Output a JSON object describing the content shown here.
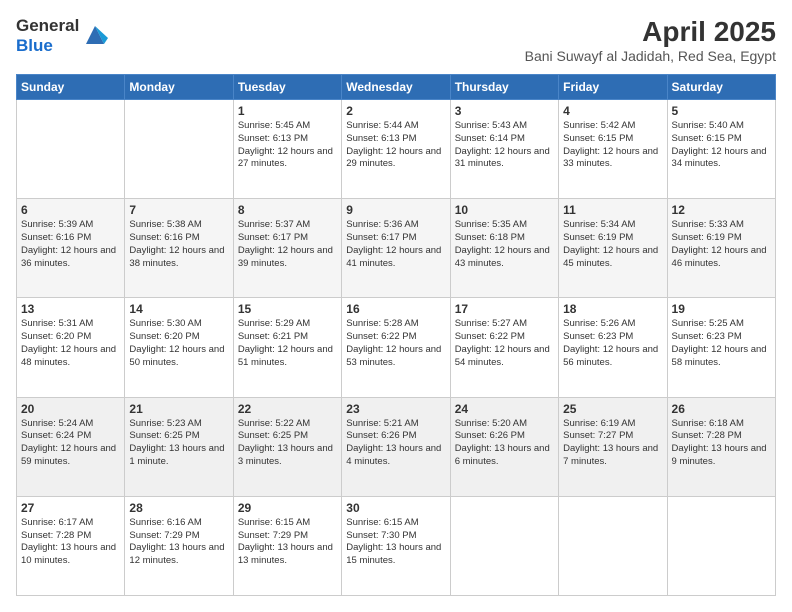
{
  "logo": {
    "line1": "General",
    "line2": "Blue"
  },
  "title": "April 2025",
  "subtitle": "Bani Suwayf al Jadidah, Red Sea, Egypt",
  "weekdays": [
    "Sunday",
    "Monday",
    "Tuesday",
    "Wednesday",
    "Thursday",
    "Friday",
    "Saturday"
  ],
  "rows": [
    [
      {
        "day": "",
        "info": ""
      },
      {
        "day": "",
        "info": ""
      },
      {
        "day": "1",
        "info": "Sunrise: 5:45 AM\nSunset: 6:13 PM\nDaylight: 12 hours and 27 minutes."
      },
      {
        "day": "2",
        "info": "Sunrise: 5:44 AM\nSunset: 6:13 PM\nDaylight: 12 hours and 29 minutes."
      },
      {
        "day": "3",
        "info": "Sunrise: 5:43 AM\nSunset: 6:14 PM\nDaylight: 12 hours and 31 minutes."
      },
      {
        "day": "4",
        "info": "Sunrise: 5:42 AM\nSunset: 6:15 PM\nDaylight: 12 hours and 33 minutes."
      },
      {
        "day": "5",
        "info": "Sunrise: 5:40 AM\nSunset: 6:15 PM\nDaylight: 12 hours and 34 minutes."
      }
    ],
    [
      {
        "day": "6",
        "info": "Sunrise: 5:39 AM\nSunset: 6:16 PM\nDaylight: 12 hours and 36 minutes."
      },
      {
        "day": "7",
        "info": "Sunrise: 5:38 AM\nSunset: 6:16 PM\nDaylight: 12 hours and 38 minutes."
      },
      {
        "day": "8",
        "info": "Sunrise: 5:37 AM\nSunset: 6:17 PM\nDaylight: 12 hours and 39 minutes."
      },
      {
        "day": "9",
        "info": "Sunrise: 5:36 AM\nSunset: 6:17 PM\nDaylight: 12 hours and 41 minutes."
      },
      {
        "day": "10",
        "info": "Sunrise: 5:35 AM\nSunset: 6:18 PM\nDaylight: 12 hours and 43 minutes."
      },
      {
        "day": "11",
        "info": "Sunrise: 5:34 AM\nSunset: 6:19 PM\nDaylight: 12 hours and 45 minutes."
      },
      {
        "day": "12",
        "info": "Sunrise: 5:33 AM\nSunset: 6:19 PM\nDaylight: 12 hours and 46 minutes."
      }
    ],
    [
      {
        "day": "13",
        "info": "Sunrise: 5:31 AM\nSunset: 6:20 PM\nDaylight: 12 hours and 48 minutes."
      },
      {
        "day": "14",
        "info": "Sunrise: 5:30 AM\nSunset: 6:20 PM\nDaylight: 12 hours and 50 minutes."
      },
      {
        "day": "15",
        "info": "Sunrise: 5:29 AM\nSunset: 6:21 PM\nDaylight: 12 hours and 51 minutes."
      },
      {
        "day": "16",
        "info": "Sunrise: 5:28 AM\nSunset: 6:22 PM\nDaylight: 12 hours and 53 minutes."
      },
      {
        "day": "17",
        "info": "Sunrise: 5:27 AM\nSunset: 6:22 PM\nDaylight: 12 hours and 54 minutes."
      },
      {
        "day": "18",
        "info": "Sunrise: 5:26 AM\nSunset: 6:23 PM\nDaylight: 12 hours and 56 minutes."
      },
      {
        "day": "19",
        "info": "Sunrise: 5:25 AM\nSunset: 6:23 PM\nDaylight: 12 hours and 58 minutes."
      }
    ],
    [
      {
        "day": "20",
        "info": "Sunrise: 5:24 AM\nSunset: 6:24 PM\nDaylight: 12 hours and 59 minutes."
      },
      {
        "day": "21",
        "info": "Sunrise: 5:23 AM\nSunset: 6:25 PM\nDaylight: 13 hours and 1 minute."
      },
      {
        "day": "22",
        "info": "Sunrise: 5:22 AM\nSunset: 6:25 PM\nDaylight: 13 hours and 3 minutes."
      },
      {
        "day": "23",
        "info": "Sunrise: 5:21 AM\nSunset: 6:26 PM\nDaylight: 13 hours and 4 minutes."
      },
      {
        "day": "24",
        "info": "Sunrise: 5:20 AM\nSunset: 6:26 PM\nDaylight: 13 hours and 6 minutes."
      },
      {
        "day": "25",
        "info": "Sunrise: 6:19 AM\nSunset: 7:27 PM\nDaylight: 13 hours and 7 minutes."
      },
      {
        "day": "26",
        "info": "Sunrise: 6:18 AM\nSunset: 7:28 PM\nDaylight: 13 hours and 9 minutes."
      }
    ],
    [
      {
        "day": "27",
        "info": "Sunrise: 6:17 AM\nSunset: 7:28 PM\nDaylight: 13 hours and 10 minutes."
      },
      {
        "day": "28",
        "info": "Sunrise: 6:16 AM\nSunset: 7:29 PM\nDaylight: 13 hours and 12 minutes."
      },
      {
        "day": "29",
        "info": "Sunrise: 6:15 AM\nSunset: 7:29 PM\nDaylight: 13 hours and 13 minutes."
      },
      {
        "day": "30",
        "info": "Sunrise: 6:15 AM\nSunset: 7:30 PM\nDaylight: 13 hours and 15 minutes."
      },
      {
        "day": "",
        "info": ""
      },
      {
        "day": "",
        "info": ""
      },
      {
        "day": "",
        "info": ""
      }
    ]
  ]
}
